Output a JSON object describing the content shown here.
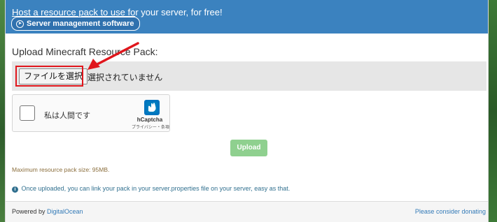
{
  "banner": {
    "link_text": "Host a resource pack to use fo",
    "rest_text": "r your server, for free!",
    "button_label": "Server management software",
    "color": "#3b82bf"
  },
  "form": {
    "title": "Upload Minecraft Resource Pack:",
    "file_button_label": "ファイルを選択",
    "file_status": "選択されていません",
    "captcha_label": "私は人間です",
    "captcha_brand": "hCaptcha",
    "captcha_sub": "プライバシー・条項",
    "upload_label": "Upload",
    "max_size": "Maximum resource pack size: 95MB.",
    "info": "Once uploaded, you can link your pack in your server.properties file on your server, easy as that."
  },
  "footer": {
    "powered_prefix": "Powered by ",
    "powered_link": "DigitalOcean",
    "donate": "Please consider donating"
  },
  "icons": {
    "server_button": "circle-arrow-icon",
    "info": "info-circle-icon",
    "annotation": "red-arrow-icon",
    "captcha_logo": "hcaptcha-logo-icon"
  },
  "colors": {
    "highlight": "#e0161c",
    "upload_button": "#8fd08f",
    "link": "#337ab7"
  }
}
